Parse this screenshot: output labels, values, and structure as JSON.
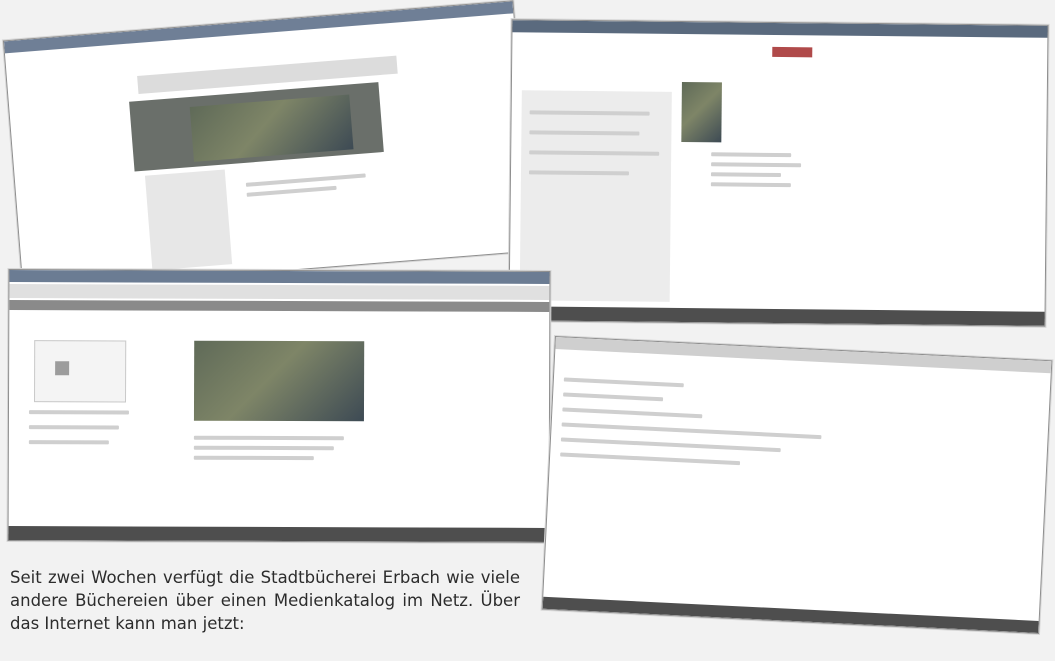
{
  "caption": {
    "text": "Seit zwei Wochen verfügt die Stadtbücherei Erbach wie viele andere Büchereien über einen Medienkatalog im Netz. Über das Internet kann man jetzt:"
  },
  "screenshots": [
    {
      "name": "library-homepage-screenshot"
    },
    {
      "name": "catalog-record-screenshot"
    },
    {
      "name": "library-website-screenshot"
    },
    {
      "name": "account-page-screenshot"
    }
  ]
}
